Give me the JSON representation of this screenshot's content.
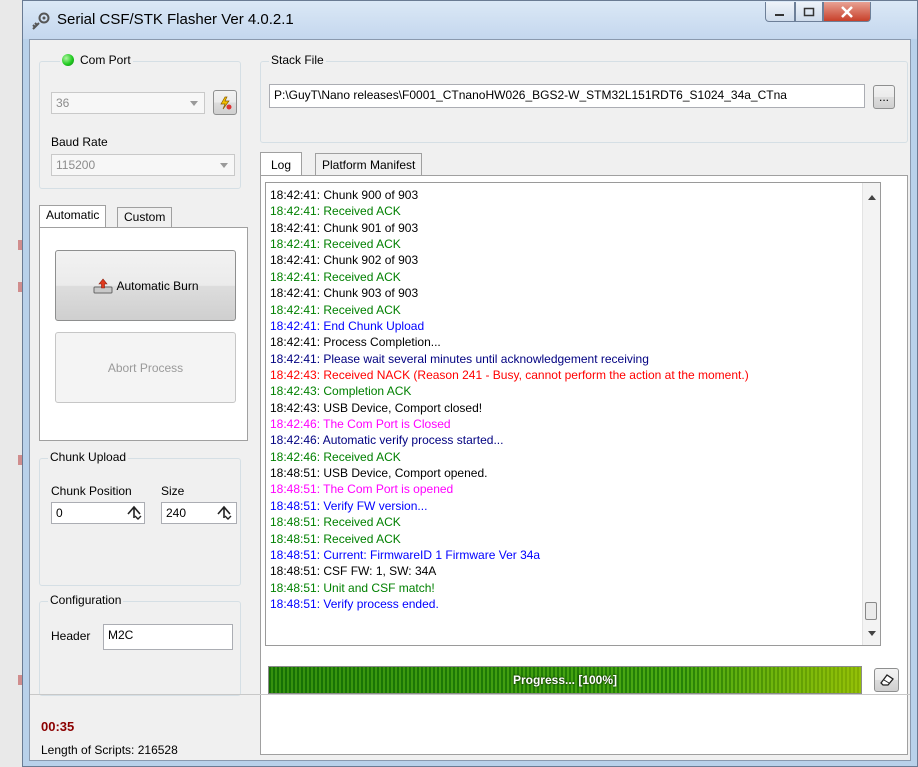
{
  "window": {
    "title": "Serial CSF/STK Flasher  Ver 4.0.2.1"
  },
  "icons": {
    "app": "gear-plug-icon",
    "refresh": "refresh-lightning-icon",
    "browse": "ellipsis-icon",
    "burn": "upload-icon",
    "clear": "eraser-icon"
  },
  "comport": {
    "label": "Com Port",
    "value": "36",
    "status_color": "#22cc22"
  },
  "baud": {
    "label": "Baud Rate",
    "value": "115200"
  },
  "burn_tabs": {
    "tabs": [
      "Automatic",
      "Custom"
    ],
    "automatic_burn": "Automatic Burn",
    "abort": "Abort Process"
  },
  "chunk": {
    "title": "Chunk Upload",
    "position_label": "Chunk Position",
    "size_label": "Size",
    "position": "0",
    "size": "240"
  },
  "config": {
    "title": "Configuration",
    "header_label": "Header",
    "header_value": "M2C"
  },
  "stack": {
    "label": "Stack File",
    "path": "P:\\GuyT\\Nano releases\\F0001_CTnanoHW026_BGS2-W_STM32L151RDT6_S1024_34a_CTna",
    "browse_label": "..."
  },
  "log_tabs": [
    "Log",
    "Platform Manifest"
  ],
  "log_colors": {
    "black": "#000000",
    "green": "#008000",
    "blue": "#0000ff",
    "navy": "#000080",
    "red": "#ff0000",
    "magenta": "#ff00ff"
  },
  "log": [
    {
      "text": "18:42:41: Chunk 900 of 903",
      "color": "#000000"
    },
    {
      "text": "18:42:41: Received ACK",
      "color": "#008000"
    },
    {
      "text": "18:42:41: Chunk 901 of 903",
      "color": "#000000"
    },
    {
      "text": "18:42:41: Received ACK",
      "color": "#008000"
    },
    {
      "text": "18:42:41: Chunk 902 of 903",
      "color": "#000000"
    },
    {
      "text": "18:42:41: Received ACK",
      "color": "#008000"
    },
    {
      "text": "18:42:41: Chunk 903 of 903",
      "color": "#000000"
    },
    {
      "text": "18:42:41: Received ACK",
      "color": "#008000"
    },
    {
      "text": "18:42:41: End Chunk Upload",
      "color": "#0000ff"
    },
    {
      "text": "18:42:41: Process Completion...",
      "color": "#000000"
    },
    {
      "text": "18:42:41: Please wait several minutes until acknowledgement receiving",
      "color": "#000080"
    },
    {
      "text": "18:42:43: Received NACK (Reason 241 - Busy, cannot perform the action at the moment.)",
      "color": "#ff0000"
    },
    {
      "text": "18:42:43: Completion ACK",
      "color": "#008000"
    },
    {
      "text": "18:42:43: USB Device, Comport closed!",
      "color": "#000000"
    },
    {
      "text": "18:42:46: The Com Port is Closed",
      "color": "#ff00ff"
    },
    {
      "text": "18:42:46: Automatic verify process started...",
      "color": "#000080"
    },
    {
      "text": "18:42:46: Received ACK",
      "color": "#008000"
    },
    {
      "text": "18:48:51: USB Device, Comport opened.",
      "color": "#000000"
    },
    {
      "text": "18:48:51: The Com Port is opened",
      "color": "#ff00ff"
    },
    {
      "text": "18:48:51: Verify FW version...",
      "color": "#0000ff"
    },
    {
      "text": "18:48:51: Received ACK",
      "color": "#008000"
    },
    {
      "text": "18:48:51: Received ACK",
      "color": "#008000"
    },
    {
      "text": "18:48:51: Current: FirmwareID 1 Firmware Ver 34a",
      "color": "#0000ff"
    },
    {
      "text": "18:48:51: CSF FW: 1, SW: 34A",
      "color": "#000000"
    },
    {
      "text": "18:48:51: Unit and CSF match!",
      "color": "#008000"
    },
    {
      "text": "18:48:51: Verify process ended.",
      "color": "#0000ff"
    }
  ],
  "progress": {
    "label": "Progress... [100%]",
    "value": 1.0
  },
  "status": {
    "timer": "00:35",
    "timer_color": "#8b0000",
    "scripts_length": "Length of Scripts: 216528"
  }
}
